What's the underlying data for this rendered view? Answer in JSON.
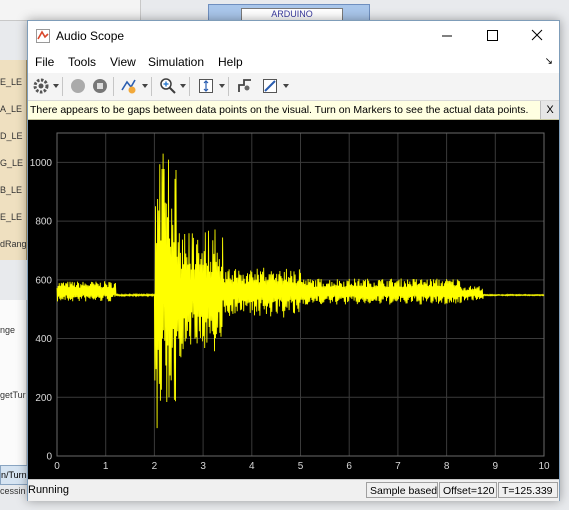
{
  "background": {
    "arduino_block": "ARDUINO",
    "left_labels": [
      "E_LE",
      "A_LE",
      "D_LE",
      "G_LE",
      "B_LE",
      "E_LE",
      "dRang"
    ],
    "side_labels": [
      "nge",
      "getTur"
    ],
    "bottom_labels": [
      "n/Turn",
      "cessin"
    ]
  },
  "window": {
    "title": "Audio Scope",
    "controls": {
      "minimize": "minimize",
      "maximize": "maximize",
      "close": "close"
    }
  },
  "menu": [
    "File",
    "Tools",
    "View",
    "Simulation",
    "Help"
  ],
  "toolbar_icons": [
    "settings-icon",
    "stop-icon",
    "step-icon",
    "highlight-icon",
    "zoom-icon",
    "scale-axes-icon",
    "measure-icon",
    "style-icon"
  ],
  "info_bar": {
    "message": "There appears to be gaps between data points on the visual. Turn on Markers to see the actual data points.",
    "close": "X"
  },
  "chart_data": {
    "type": "line",
    "xlim": [
      0,
      10
    ],
    "ylim": [
      0,
      1100
    ],
    "x_ticks": [
      0,
      1,
      2,
      3,
      4,
      5,
      6,
      7,
      8,
      9,
      10
    ],
    "y_ticks": [
      0,
      200,
      400,
      600,
      800,
      1000
    ],
    "grid": true,
    "line_color": "#ffff00",
    "background": "#000000",
    "series": [
      {
        "segments": [
          {
            "t_start": 0.0,
            "t_end": 1.2,
            "baseline": 560,
            "amplitude": 35
          },
          {
            "t_start": 1.2,
            "t_end": 2.0,
            "baseline": 548,
            "amplitude": 3
          },
          {
            "t_start": 2.0,
            "t_end": 2.45,
            "baseline": 560,
            "amplitude": 480
          },
          {
            "t_start": 2.45,
            "t_end": 3.4,
            "baseline": 560,
            "amplitude": 230
          },
          {
            "t_start": 3.4,
            "t_end": 5.0,
            "baseline": 560,
            "amplitude": 90
          },
          {
            "t_start": 5.0,
            "t_end": 8.3,
            "baseline": 560,
            "amplitude": 45
          },
          {
            "t_start": 8.3,
            "t_end": 8.75,
            "baseline": 555,
            "amplitude": 25
          },
          {
            "t_start": 8.75,
            "t_end": 10.0,
            "baseline": 548,
            "amplitude": 2
          }
        ],
        "peak_high": 1030,
        "peak_low": 95
      }
    ]
  },
  "status": {
    "state": "Running",
    "mode": "Sample based",
    "offset": "Offset=120",
    "time": "T=125.339"
  }
}
